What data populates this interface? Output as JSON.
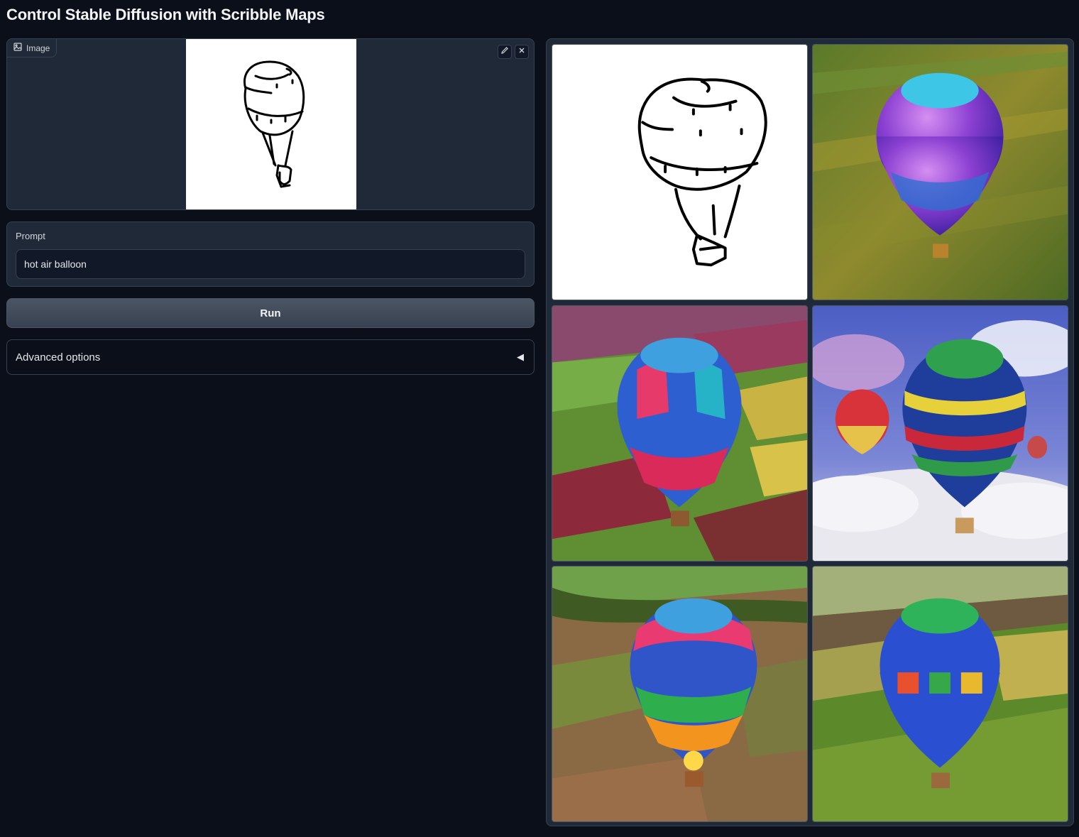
{
  "header": {
    "title": "Control Stable Diffusion with Scribble Maps"
  },
  "image_input": {
    "label": "Image",
    "label_icon": "image-icon",
    "edit_icon": "pencil-icon",
    "clear_icon": "close-icon"
  },
  "prompt": {
    "label": "Prompt",
    "value": "hot air balloon"
  },
  "run_button": {
    "label": "Run"
  },
  "advanced": {
    "label": "Advanced options",
    "arrow": "◀"
  },
  "gallery": {
    "items": [
      {
        "kind": "scribble-map"
      },
      {
        "kind": "generated",
        "scene": "farmland",
        "balloon": "purple"
      },
      {
        "kind": "generated",
        "scene": "patchwork fields",
        "balloon": "multicolor"
      },
      {
        "kind": "generated",
        "scene": "clouds",
        "balloon": "striped"
      },
      {
        "kind": "generated",
        "scene": "fields with trees",
        "balloon": "rainbow"
      },
      {
        "kind": "generated",
        "scene": "green fields",
        "balloon": "blue"
      }
    ]
  },
  "colors": {
    "background": "#0b0f19",
    "panel": "#1f2937",
    "border": "#374151"
  }
}
